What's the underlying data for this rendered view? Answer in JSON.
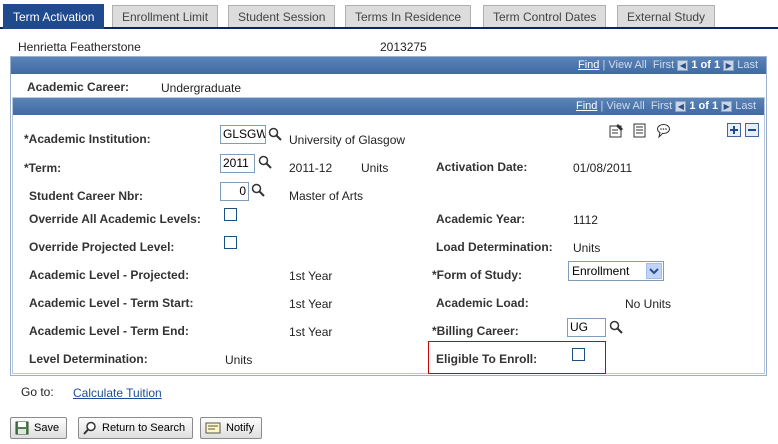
{
  "tabs": [
    {
      "label": "Term Activation",
      "active": true
    },
    {
      "label": "Enrollment Limit"
    },
    {
      "label": "Student Session"
    },
    {
      "label": "Terms In Residence"
    },
    {
      "label": "Term Control Dates"
    },
    {
      "label": "External Study"
    }
  ],
  "header": {
    "name": "Henrietta Featherstone",
    "id": "2013275"
  },
  "nav": {
    "find": "Find",
    "view_all": "View All",
    "first": "First",
    "pos": "1 of 1",
    "last": "Last"
  },
  "career": {
    "label": "Academic Career:",
    "value": "Undergraduate"
  },
  "form": {
    "institution_label": "*Academic Institution:",
    "institution_code": "GLSGW",
    "institution_desc": "University of Glasgow",
    "term_label": "*Term:",
    "term_value": "2011",
    "term_desc": "2011-12",
    "term_units": "Units",
    "activation_date_label": "Activation Date:",
    "activation_date_value": "01/08/2011",
    "career_nbr_label": "Student Career Nbr:",
    "career_nbr_value": "0",
    "career_nbr_desc": "Master of Arts",
    "override_levels_label": "Override All Academic Levels:",
    "academic_year_label": "Academic Year:",
    "academic_year_value": "1112",
    "override_projected_label": "Override Projected Level:",
    "load_determination_label": "Load Determination:",
    "load_determination_value": "Units",
    "level_projected_label": "Academic Level - Projected:",
    "level_projected_value": "1st Year",
    "form_of_study_label": "*Form of Study:",
    "form_of_study_value": "Enrollment",
    "level_term_start_label": "Academic Level - Term Start:",
    "level_term_start_value": "1st Year",
    "academic_load_label": "Academic Load:",
    "academic_load_value": "No Units",
    "level_term_end_label": "Academic Level - Term End:",
    "level_term_end_value": "1st Year",
    "billing_career_label": "*Billing Career:",
    "billing_career_value": "UG",
    "level_determination_label": "Level Determination:",
    "level_determination_value": "Units",
    "eligible_label": "Eligible To Enroll:"
  },
  "goto": {
    "label": "Go to:",
    "link": "Calculate Tuition"
  },
  "buttons": {
    "save": "Save",
    "return": "Return to Search",
    "notify": "Notify"
  },
  "colors": {
    "tab_active": "#1f4a8d",
    "nav_bar": "#4a75ad",
    "highlight": "#cc0000",
    "link": "#1f4a9c"
  }
}
